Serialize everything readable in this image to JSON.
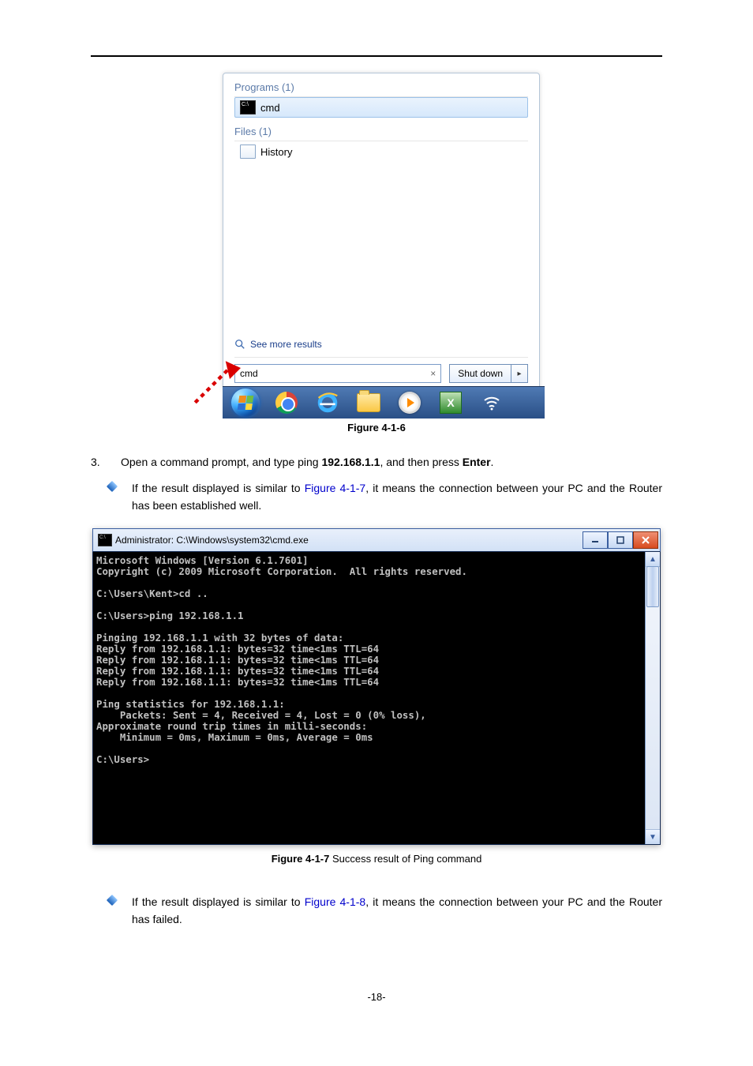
{
  "fig1": {
    "programs_label": "Programs (1)",
    "program_item": "cmd",
    "files_label": "Files (1)",
    "file_item": "History",
    "see_more": "See more results",
    "search_value": "cmd",
    "clear_glyph": "×",
    "shutdown_label": "Shut down",
    "shutdown_arrow": "▸"
  },
  "fig1_caption": "Figure 4-1-6",
  "step3": {
    "num": "3.",
    "text_a": "Open a command prompt, and type ping ",
    "ip": "192.168.1.1",
    "text_b": ", and then press ",
    "enter": "Enter",
    "period": "."
  },
  "bullet1": {
    "pre": "If the result displayed is similar to ",
    "link": "Figure 4-1-7",
    "post": ", it means the connection between your PC and the Router has been established well."
  },
  "cmd": {
    "title": "Administrator: C:\\Windows\\system32\\cmd.exe",
    "body": "Microsoft Windows [Version 6.1.7601]\nCopyright (c) 2009 Microsoft Corporation.  All rights reserved.\n\nC:\\Users\\Kent>cd ..\n\nC:\\Users>ping 192.168.1.1\n\nPinging 192.168.1.1 with 32 bytes of data:\nReply from 192.168.1.1: bytes=32 time<1ms TTL=64\nReply from 192.168.1.1: bytes=32 time<1ms TTL=64\nReply from 192.168.1.1: bytes=32 time<1ms TTL=64\nReply from 192.168.1.1: bytes=32 time<1ms TTL=64\n\nPing statistics for 192.168.1.1:\n    Packets: Sent = 4, Received = 4, Lost = 0 (0% loss),\nApproximate round trip times in milli-seconds:\n    Minimum = 0ms, Maximum = 0ms, Average = 0ms\n\nC:\\Users>"
  },
  "fig2_caption_b": "Figure 4-1-7",
  "fig2_caption_rest": " Success result of Ping command",
  "bullet2": {
    "pre": "If the result displayed is similar to ",
    "link": "Figure 4-1-8",
    "post": ", it means the connection between your PC and the Router has failed."
  },
  "page_num": "-18-"
}
